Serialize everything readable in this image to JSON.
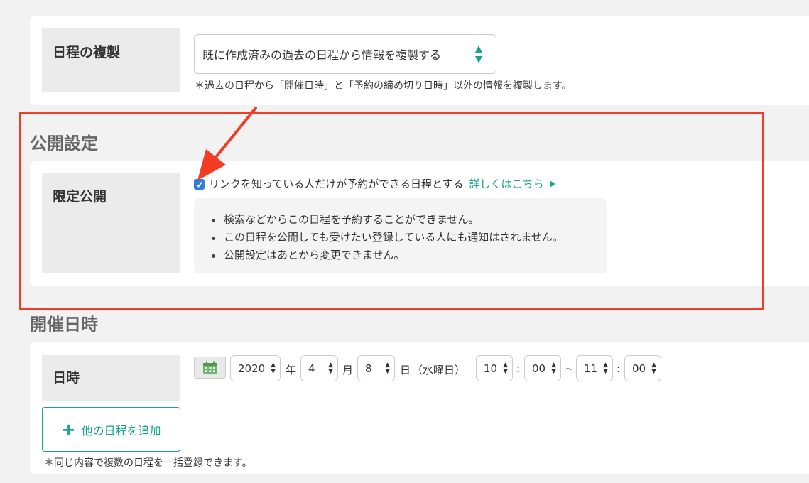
{
  "duplicate_section": {
    "label": "日程の複製",
    "select_value": "既に作成済みの過去の日程から情報を複製する",
    "note": "＊過去の日程から「開催日時」と「予約の締め切り日時」以外の情報を複製します。"
  },
  "visibility_section": {
    "heading": "公開設定",
    "label": "限定公開",
    "checkbox_label": "リンクを知っている人だけが予約ができる日程とする",
    "checkbox_checked": true,
    "details_link": "詳しくはこちら",
    "info_items": [
      "検索などからこの日程を予約することができません。",
      "この日程を公開しても受けたい登録している人にも通知はされません。",
      "公開設定はあとから変更できません。"
    ]
  },
  "datetime_section": {
    "heading": "開催日時",
    "label": "日時",
    "year": "2020",
    "year_unit": "年",
    "month": "4",
    "month_unit": "月",
    "day": "8",
    "day_unit": "日",
    "weekday": "（水曜日）",
    "start_hour": "10",
    "start_minute": "00",
    "end_hour": "11",
    "end_minute": "00",
    "time_colon": ":",
    "range_sep": "~",
    "add_button": "他の日程を追加",
    "add_button_icon": "+",
    "note": "＊同じ内容で複数の日程を一括登録できます。"
  },
  "colors": {
    "accent": "#1aa38a",
    "highlight_border": "#f23c26",
    "checkbox": "#2f7de1"
  }
}
